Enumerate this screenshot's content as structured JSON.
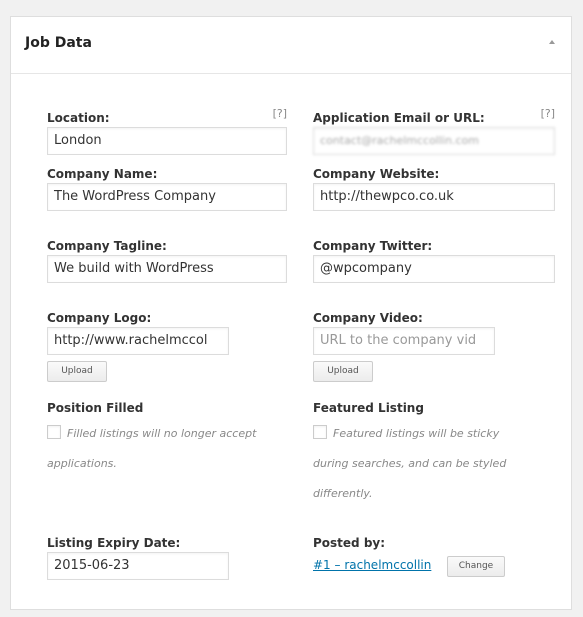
{
  "metabox": {
    "title": "Job Data"
  },
  "help_marker": "[?]",
  "location": {
    "label": "Location:",
    "value": "London"
  },
  "application": {
    "label": "Application Email or URL:",
    "value": "contact@rachelmccollin.com"
  },
  "company_name": {
    "label": "Company Name:",
    "value": "The WordPress Company"
  },
  "company_website": {
    "label": "Company Website:",
    "value": "http://thewpco.co.uk"
  },
  "company_tagline": {
    "label": "Company Tagline:",
    "value": "We build with WordPress"
  },
  "company_twitter": {
    "label": "Company Twitter:",
    "value": "@wpcompany"
  },
  "company_logo": {
    "label": "Company Logo:",
    "value": "http://www.rachelmccol",
    "upload_label": "Upload"
  },
  "company_video": {
    "label": "Company Video:",
    "placeholder": "URL to the company vid",
    "upload_label": "Upload"
  },
  "position_filled": {
    "label": "Position Filled",
    "desc_line1": "Filled listings will no longer accept",
    "desc_line2": "applications.",
    "checked": false
  },
  "featured_listing": {
    "label": "Featured Listing",
    "desc_line1": "Featured listings will be sticky",
    "desc_line2": "during searches, and can be styled",
    "desc_line3": "differently.",
    "checked": false
  },
  "expiry": {
    "label": "Listing Expiry Date:",
    "value": "2015-06-23"
  },
  "posted_by": {
    "label": "Posted by:",
    "link": "#1 – rachelmccollin",
    "change_label": "Change"
  }
}
